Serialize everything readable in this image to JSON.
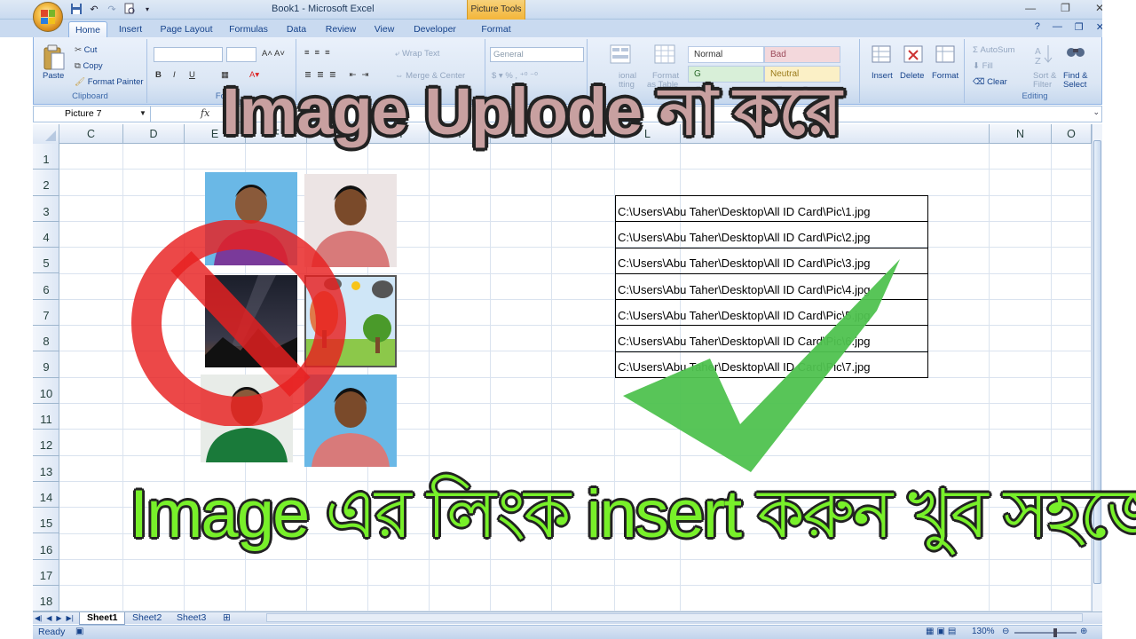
{
  "window": {
    "title": "Book1 - Microsoft Excel",
    "context_tab": "Picture Tools"
  },
  "tabs": [
    "Home",
    "Insert",
    "Page Layout",
    "Formulas",
    "Data",
    "Review",
    "View",
    "Developer",
    "Format"
  ],
  "ribbon": {
    "clipboard": {
      "paste": "Paste",
      "cut": "Cut",
      "copy": "Copy",
      "format_painter": "Format Painter",
      "label": "Clipboard"
    },
    "font": {
      "label": "Fon"
    },
    "alignment": {
      "wrap_text": "Wrap Text",
      "merge_center": "Merge & Center",
      "label": "A"
    },
    "number": {
      "format": "General",
      "label": "N"
    },
    "styles": {
      "conditional": "ional",
      "conditional2": "tting",
      "format_as_table": "Format",
      "format_as_table2": "as Table",
      "normal": "Normal",
      "bad": "Bad",
      "good": "G",
      "neutral": "Neutral"
    },
    "cells": {
      "insert": "Insert",
      "delete": "Delete",
      "format": "Format"
    },
    "editing": {
      "autosum": "AutoSum",
      "fill": "Fill",
      "clear": "Clear",
      "sort_filter": "Sort &",
      "sort_filter2": "Filter",
      "find_select": "Find &",
      "find_select2": "Select",
      "label": "Editing"
    }
  },
  "formula_bar": {
    "name_box": "Picture 7",
    "fx": "fx"
  },
  "columns": [
    "C",
    "D",
    "E",
    "F",
    "G",
    "H",
    "I",
    "J",
    "K",
    "L",
    "M",
    "N",
    "O"
  ],
  "rows": [
    "1",
    "2",
    "3",
    "4",
    "5",
    "6",
    "7",
    "8",
    "9",
    "10",
    "11",
    "12",
    "13",
    "14",
    "15",
    "16",
    "17",
    "18"
  ],
  "links": [
    "C:\\Users\\Abu Taher\\Desktop\\All ID Card\\Pic\\1.jpg",
    "C:\\Users\\Abu Taher\\Desktop\\All ID Card\\Pic\\2.jpg",
    "C:\\Users\\Abu Taher\\Desktop\\All ID Card\\Pic\\3.jpg",
    "C:\\Users\\Abu Taher\\Desktop\\All ID Card\\Pic\\4.jpg",
    "C:\\Users\\Abu Taher\\Desktop\\All ID Card\\Pic\\5.jpg",
    "C:\\Users\\Abu Taher\\Desktop\\All ID Card\\Pic\\6.jpg",
    "C:\\Users\\Abu Taher\\Desktop\\All ID Card\\Pic\\7.jpg"
  ],
  "overlay": {
    "headline": "Image Uplode না করে",
    "subline": "Image এর লিংক insert করুন খুব সহজেই"
  },
  "sheets": [
    "Sheet1",
    "Sheet2",
    "Sheet3"
  ],
  "status": {
    "ready": "Ready",
    "zoom": "130%"
  },
  "colors": {
    "headline": "#c8a0a0",
    "subline": "#78f02a",
    "check": "#4fc24f",
    "no_sign": "#e82020"
  },
  "icons": [
    "office-button-icon",
    "save-icon",
    "undo-icon",
    "redo-icon",
    "print-preview-icon",
    "no-sign-icon",
    "checkmark-icon"
  ]
}
